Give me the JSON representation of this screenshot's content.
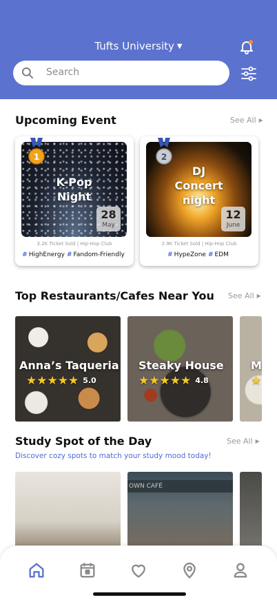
{
  "header": {
    "location": "Tufts University",
    "search_placeholder": "Search"
  },
  "upcoming": {
    "title": "Upcoming Event",
    "see_all": "See All",
    "events": [
      {
        "rank": "1",
        "title_line1": "K-Pop",
        "title_line2": "Night",
        "day": "28",
        "month": "May",
        "meta": "3.2K Ticket Sold | Hip-Hop Club",
        "tags": [
          "HighEnergy",
          "Fandom-Friendly"
        ]
      },
      {
        "rank": "2",
        "title_line1": "DJ",
        "title_line2": "Concert",
        "title_line3": "night",
        "day": "12",
        "month": "June",
        "meta": "2.9K Ticket Sold | Hip-Hop Club",
        "tags": [
          "HypeZone",
          "EDM"
        ]
      }
    ]
  },
  "restaurants": {
    "title": "Top Restaurants/Cafes Near You",
    "see_all": "See All",
    "items": [
      {
        "name": "Anna’s Taqueria",
        "rating": "5.0",
        "stars": 5
      },
      {
        "name": "Steaky House",
        "rating": "4.8",
        "stars": 5
      },
      {
        "name": "M"
      }
    ]
  },
  "study": {
    "title": "Study Spot of the Day",
    "see_all": "See All",
    "subtitle": "Discover cozy spots to match your study mood today!",
    "awning_text": "OWN CAFÉ"
  },
  "tabbar": {
    "tabs": [
      "home-icon",
      "calendar-icon",
      "heart-icon",
      "location-pin-icon",
      "profile-icon"
    ],
    "active_color": "#5b72cf",
    "inactive_color": "#8a8a8a"
  },
  "colors": {
    "header_bg": "#5b72cf",
    "accent": "#4e6bd4",
    "star": "#f7c824"
  }
}
